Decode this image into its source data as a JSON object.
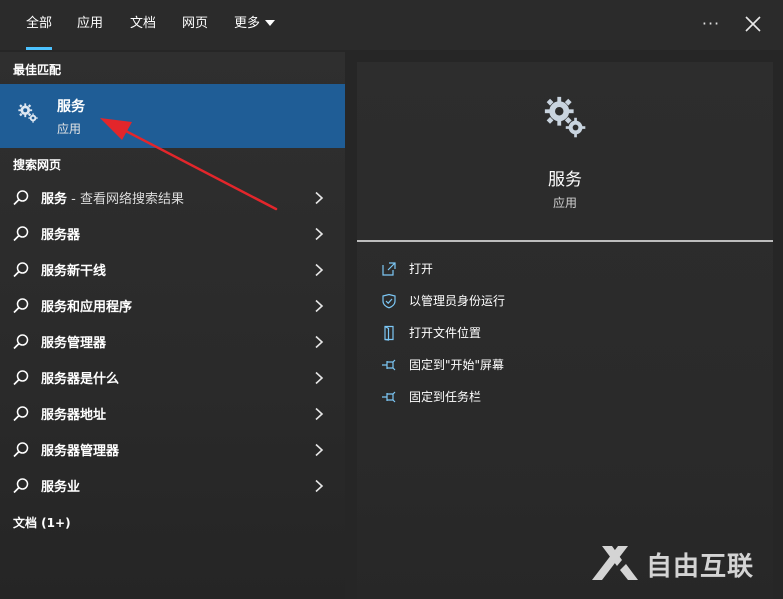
{
  "tabs": [
    {
      "label": "全部",
      "active": true
    },
    {
      "label": "应用",
      "active": false
    },
    {
      "label": "文档",
      "active": false
    },
    {
      "label": "网页",
      "active": false
    },
    {
      "label": "更多",
      "active": false
    }
  ],
  "topbar": {
    "more_icon": "ellipsis-icon",
    "close_icon": "close-icon"
  },
  "left": {
    "best_match_header": "最佳匹配",
    "best_match": {
      "title": "服务",
      "subtitle": "应用",
      "icon": "gear-icon"
    },
    "search_web_header": "搜索网页",
    "results": [
      {
        "label": "服务",
        "suffix": " - 查看网络搜索结果"
      },
      {
        "label": "服务器",
        "suffix": ""
      },
      {
        "label": "服务新干线",
        "suffix": ""
      },
      {
        "label": "服务和应用程序",
        "suffix": ""
      },
      {
        "label": "服务管理器",
        "suffix": ""
      },
      {
        "label": "服务器是什么",
        "suffix": ""
      },
      {
        "label": "服务器地址",
        "suffix": ""
      },
      {
        "label": "服务器管理器",
        "suffix": ""
      },
      {
        "label": "服务业",
        "suffix": ""
      }
    ],
    "documents_header": "文档 (1+)"
  },
  "right": {
    "title": "服务",
    "subtitle": "应用",
    "actions": [
      {
        "label": "打开",
        "icon": "open-icon"
      },
      {
        "label": "以管理员身份运行",
        "icon": "shield-icon"
      },
      {
        "label": "打开文件位置",
        "icon": "file-location-icon"
      },
      {
        "label": "固定到\"开始\"屏幕",
        "icon": "pin-icon"
      },
      {
        "label": "固定到任务栏",
        "icon": "pin-icon"
      }
    ]
  },
  "watermark": {
    "text": "自由互联"
  },
  "colors": {
    "accent": "#4cc2ff",
    "selected_bg": "#1f5d96",
    "arrow": "#e3262b"
  }
}
